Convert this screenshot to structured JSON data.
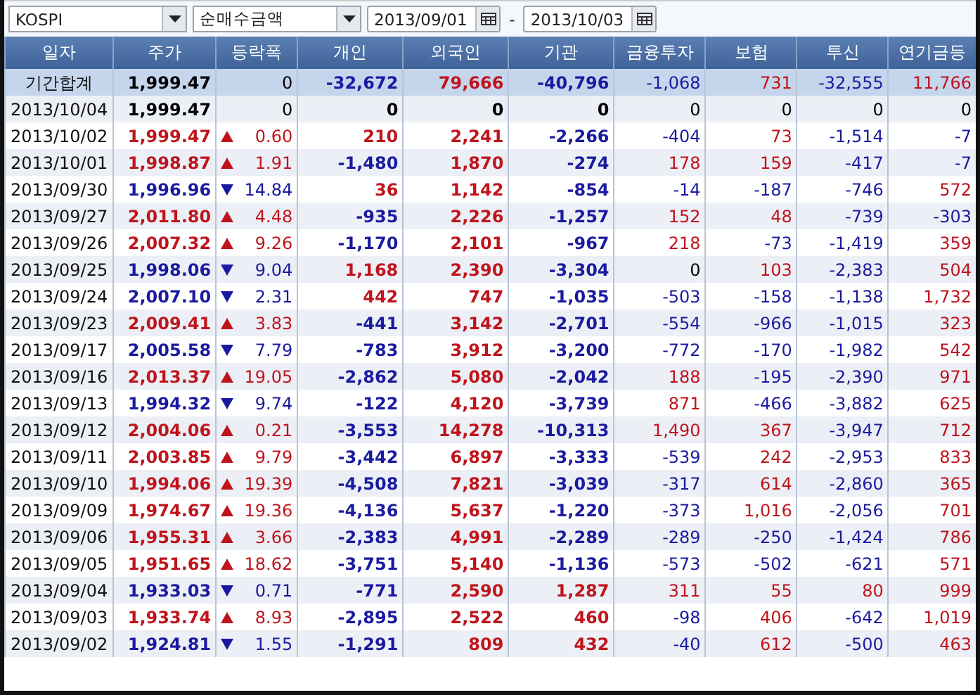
{
  "toolbar": {
    "market": {
      "value": "KOSPI"
    },
    "measure": {
      "value": "순매수금액"
    },
    "date_from": {
      "value": "2013/09/01"
    },
    "separator": "-",
    "date_to": {
      "value": "2013/10/03"
    }
  },
  "table": {
    "columns": [
      "일자",
      "주가",
      "등락폭",
      "개인",
      "외국인",
      "기관",
      "금융투자",
      "보험",
      "투신",
      "연기금등"
    ],
    "summary": {
      "cells": [
        {
          "text": "기간합계"
        },
        {
          "text": "1,999.47",
          "color": "#000000"
        },
        {
          "text": "0",
          "color": "#000000"
        },
        {
          "text": "-32,672",
          "color": "#1a1aa0"
        },
        {
          "text": "79,666",
          "color": "#c0141c"
        },
        {
          "text": "-40,796",
          "color": "#1a1aa0"
        },
        {
          "text": "-1,068",
          "color": "#1a1aa0"
        },
        {
          "text": "731",
          "color": "#c0141c"
        },
        {
          "text": "-32,555",
          "color": "#1a1aa0"
        },
        {
          "text": "11,766",
          "color": "#c0141c"
        }
      ]
    },
    "rows": [
      {
        "cells": [
          {
            "text": "2013/10/04"
          },
          {
            "text": "1,999.47",
            "color": "#000000"
          },
          {
            "text": "0",
            "color": "#000000"
          },
          {
            "text": "0",
            "color": "#000000"
          },
          {
            "text": "0",
            "color": "#000000"
          },
          {
            "text": "0",
            "color": "#000000"
          },
          {
            "text": "0",
            "color": "#000000"
          },
          {
            "text": "0",
            "color": "#000000"
          },
          {
            "text": "0",
            "color": "#000000"
          },
          {
            "text": "0",
            "color": "#000000"
          }
        ]
      },
      {
        "cells": [
          {
            "text": "2013/10/02"
          },
          {
            "text": "1,999.47",
            "color": "#c0141c"
          },
          {
            "text": "0.60",
            "color": "#c0141c",
            "rising": true
          },
          {
            "text": "210",
            "color": "#c0141c"
          },
          {
            "text": "2,241",
            "color": "#c0141c"
          },
          {
            "text": "-2,266",
            "color": "#1a1aa0"
          },
          {
            "text": "-404",
            "color": "#1a1aa0"
          },
          {
            "text": "73",
            "color": "#c0141c"
          },
          {
            "text": "-1,514",
            "color": "#1a1aa0"
          },
          {
            "text": "-7",
            "color": "#1a1aa0"
          }
        ]
      },
      {
        "cells": [
          {
            "text": "2013/10/01"
          },
          {
            "text": "1,998.87",
            "color": "#c0141c"
          },
          {
            "text": "1.91",
            "color": "#c0141c",
            "rising": true
          },
          {
            "text": "-1,480",
            "color": "#1a1aa0"
          },
          {
            "text": "1,870",
            "color": "#c0141c"
          },
          {
            "text": "-274",
            "color": "#1a1aa0"
          },
          {
            "text": "178",
            "color": "#c0141c"
          },
          {
            "text": "159",
            "color": "#c0141c"
          },
          {
            "text": "-417",
            "color": "#1a1aa0"
          },
          {
            "text": "-7",
            "color": "#1a1aa0"
          }
        ]
      },
      {
        "cells": [
          {
            "text": "2013/09/30"
          },
          {
            "text": "1,996.96",
            "color": "#1a1aa0"
          },
          {
            "text": "14.84",
            "color": "#1a1aa0",
            "falling": true
          },
          {
            "text": "36",
            "color": "#c0141c"
          },
          {
            "text": "1,142",
            "color": "#c0141c"
          },
          {
            "text": "-854",
            "color": "#1a1aa0"
          },
          {
            "text": "-14",
            "color": "#1a1aa0"
          },
          {
            "text": "-187",
            "color": "#1a1aa0"
          },
          {
            "text": "-746",
            "color": "#1a1aa0"
          },
          {
            "text": "572",
            "color": "#c0141c"
          }
        ]
      },
      {
        "cells": [
          {
            "text": "2013/09/27"
          },
          {
            "text": "2,011.80",
            "color": "#c0141c"
          },
          {
            "text": "4.48",
            "color": "#c0141c",
            "rising": true
          },
          {
            "text": "-935",
            "color": "#1a1aa0"
          },
          {
            "text": "2,226",
            "color": "#c0141c"
          },
          {
            "text": "-1,257",
            "color": "#1a1aa0"
          },
          {
            "text": "152",
            "color": "#c0141c"
          },
          {
            "text": "48",
            "color": "#c0141c"
          },
          {
            "text": "-739",
            "color": "#1a1aa0"
          },
          {
            "text": "-303",
            "color": "#1a1aa0"
          }
        ]
      },
      {
        "cells": [
          {
            "text": "2013/09/26"
          },
          {
            "text": "2,007.32",
            "color": "#c0141c"
          },
          {
            "text": "9.26",
            "color": "#c0141c",
            "rising": true
          },
          {
            "text": "-1,170",
            "color": "#1a1aa0"
          },
          {
            "text": "2,101",
            "color": "#c0141c"
          },
          {
            "text": "-967",
            "color": "#1a1aa0"
          },
          {
            "text": "218",
            "color": "#c0141c"
          },
          {
            "text": "-73",
            "color": "#1a1aa0"
          },
          {
            "text": "-1,419",
            "color": "#1a1aa0"
          },
          {
            "text": "359",
            "color": "#c0141c"
          }
        ]
      },
      {
        "cells": [
          {
            "text": "2013/09/25"
          },
          {
            "text": "1,998.06",
            "color": "#1a1aa0"
          },
          {
            "text": "9.04",
            "color": "#1a1aa0",
            "falling": true
          },
          {
            "text": "1,168",
            "color": "#c0141c"
          },
          {
            "text": "2,390",
            "color": "#c0141c"
          },
          {
            "text": "-3,304",
            "color": "#1a1aa0"
          },
          {
            "text": "0",
            "color": "#000000"
          },
          {
            "text": "103",
            "color": "#c0141c"
          },
          {
            "text": "-2,383",
            "color": "#1a1aa0"
          },
          {
            "text": "504",
            "color": "#c0141c"
          }
        ]
      },
      {
        "cells": [
          {
            "text": "2013/09/24"
          },
          {
            "text": "2,007.10",
            "color": "#1a1aa0"
          },
          {
            "text": "2.31",
            "color": "#1a1aa0",
            "falling": true
          },
          {
            "text": "442",
            "color": "#c0141c"
          },
          {
            "text": "747",
            "color": "#c0141c"
          },
          {
            "text": "-1,035",
            "color": "#1a1aa0"
          },
          {
            "text": "-503",
            "color": "#1a1aa0"
          },
          {
            "text": "-158",
            "color": "#1a1aa0"
          },
          {
            "text": "-1,138",
            "color": "#1a1aa0"
          },
          {
            "text": "1,732",
            "color": "#c0141c"
          }
        ]
      },
      {
        "cells": [
          {
            "text": "2013/09/23"
          },
          {
            "text": "2,009.41",
            "color": "#c0141c"
          },
          {
            "text": "3.83",
            "color": "#c0141c",
            "rising": true
          },
          {
            "text": "-441",
            "color": "#1a1aa0"
          },
          {
            "text": "3,142",
            "color": "#c0141c"
          },
          {
            "text": "-2,701",
            "color": "#1a1aa0"
          },
          {
            "text": "-554",
            "color": "#1a1aa0"
          },
          {
            "text": "-966",
            "color": "#1a1aa0"
          },
          {
            "text": "-1,015",
            "color": "#1a1aa0"
          },
          {
            "text": "323",
            "color": "#c0141c"
          }
        ]
      },
      {
        "cells": [
          {
            "text": "2013/09/17"
          },
          {
            "text": "2,005.58",
            "color": "#1a1aa0"
          },
          {
            "text": "7.79",
            "color": "#1a1aa0",
            "falling": true
          },
          {
            "text": "-783",
            "color": "#1a1aa0"
          },
          {
            "text": "3,912",
            "color": "#c0141c"
          },
          {
            "text": "-3,200",
            "color": "#1a1aa0"
          },
          {
            "text": "-772",
            "color": "#1a1aa0"
          },
          {
            "text": "-170",
            "color": "#1a1aa0"
          },
          {
            "text": "-1,982",
            "color": "#1a1aa0"
          },
          {
            "text": "542",
            "color": "#c0141c"
          }
        ]
      },
      {
        "cells": [
          {
            "text": "2013/09/16"
          },
          {
            "text": "2,013.37",
            "color": "#c0141c"
          },
          {
            "text": "19.05",
            "color": "#c0141c",
            "rising": true
          },
          {
            "text": "-2,862",
            "color": "#1a1aa0"
          },
          {
            "text": "5,080",
            "color": "#c0141c"
          },
          {
            "text": "-2,042",
            "color": "#1a1aa0"
          },
          {
            "text": "188",
            "color": "#c0141c"
          },
          {
            "text": "-195",
            "color": "#1a1aa0"
          },
          {
            "text": "-2,390",
            "color": "#1a1aa0"
          },
          {
            "text": "971",
            "color": "#c0141c"
          }
        ]
      },
      {
        "cells": [
          {
            "text": "2013/09/13"
          },
          {
            "text": "1,994.32",
            "color": "#1a1aa0"
          },
          {
            "text": "9.74",
            "color": "#1a1aa0",
            "falling": true
          },
          {
            "text": "-122",
            "color": "#1a1aa0"
          },
          {
            "text": "4,120",
            "color": "#c0141c"
          },
          {
            "text": "-3,739",
            "color": "#1a1aa0"
          },
          {
            "text": "871",
            "color": "#c0141c"
          },
          {
            "text": "-466",
            "color": "#1a1aa0"
          },
          {
            "text": "-3,882",
            "color": "#1a1aa0"
          },
          {
            "text": "625",
            "color": "#c0141c"
          }
        ]
      },
      {
        "cells": [
          {
            "text": "2013/09/12"
          },
          {
            "text": "2,004.06",
            "color": "#c0141c"
          },
          {
            "text": "0.21",
            "color": "#c0141c",
            "rising": true
          },
          {
            "text": "-3,553",
            "color": "#1a1aa0"
          },
          {
            "text": "14,278",
            "color": "#c0141c"
          },
          {
            "text": "-10,313",
            "color": "#1a1aa0"
          },
          {
            "text": "1,490",
            "color": "#c0141c"
          },
          {
            "text": "367",
            "color": "#c0141c"
          },
          {
            "text": "-3,947",
            "color": "#1a1aa0"
          },
          {
            "text": "712",
            "color": "#c0141c"
          }
        ]
      },
      {
        "cells": [
          {
            "text": "2013/09/11"
          },
          {
            "text": "2,003.85",
            "color": "#c0141c"
          },
          {
            "text": "9.79",
            "color": "#c0141c",
            "rising": true
          },
          {
            "text": "-3,442",
            "color": "#1a1aa0"
          },
          {
            "text": "6,897",
            "color": "#c0141c"
          },
          {
            "text": "-3,333",
            "color": "#1a1aa0"
          },
          {
            "text": "-539",
            "color": "#1a1aa0"
          },
          {
            "text": "242",
            "color": "#c0141c"
          },
          {
            "text": "-2,953",
            "color": "#1a1aa0"
          },
          {
            "text": "833",
            "color": "#c0141c"
          }
        ]
      },
      {
        "cells": [
          {
            "text": "2013/09/10"
          },
          {
            "text": "1,994.06",
            "color": "#c0141c"
          },
          {
            "text": "19.39",
            "color": "#c0141c",
            "rising": true
          },
          {
            "text": "-4,508",
            "color": "#1a1aa0"
          },
          {
            "text": "7,821",
            "color": "#c0141c"
          },
          {
            "text": "-3,039",
            "color": "#1a1aa0"
          },
          {
            "text": "-317",
            "color": "#1a1aa0"
          },
          {
            "text": "614",
            "color": "#c0141c"
          },
          {
            "text": "-2,860",
            "color": "#1a1aa0"
          },
          {
            "text": "365",
            "color": "#c0141c"
          }
        ]
      },
      {
        "cells": [
          {
            "text": "2013/09/09"
          },
          {
            "text": "1,974.67",
            "color": "#c0141c"
          },
          {
            "text": "19.36",
            "color": "#c0141c",
            "rising": true
          },
          {
            "text": "-4,136",
            "color": "#1a1aa0"
          },
          {
            "text": "5,637",
            "color": "#c0141c"
          },
          {
            "text": "-1,220",
            "color": "#1a1aa0"
          },
          {
            "text": "-373",
            "color": "#1a1aa0"
          },
          {
            "text": "1,016",
            "color": "#c0141c"
          },
          {
            "text": "-2,056",
            "color": "#1a1aa0"
          },
          {
            "text": "701",
            "color": "#c0141c"
          }
        ]
      },
      {
        "cells": [
          {
            "text": "2013/09/06"
          },
          {
            "text": "1,955.31",
            "color": "#c0141c"
          },
          {
            "text": "3.66",
            "color": "#c0141c",
            "rising": true
          },
          {
            "text": "-2,383",
            "color": "#1a1aa0"
          },
          {
            "text": "4,991",
            "color": "#c0141c"
          },
          {
            "text": "-2,289",
            "color": "#1a1aa0"
          },
          {
            "text": "-289",
            "color": "#1a1aa0"
          },
          {
            "text": "-250",
            "color": "#1a1aa0"
          },
          {
            "text": "-1,424",
            "color": "#1a1aa0"
          },
          {
            "text": "786",
            "color": "#c0141c"
          }
        ]
      },
      {
        "cells": [
          {
            "text": "2013/09/05"
          },
          {
            "text": "1,951.65",
            "color": "#c0141c"
          },
          {
            "text": "18.62",
            "color": "#c0141c",
            "rising": true
          },
          {
            "text": "-3,751",
            "color": "#1a1aa0"
          },
          {
            "text": "5,140",
            "color": "#c0141c"
          },
          {
            "text": "-1,136",
            "color": "#1a1aa0"
          },
          {
            "text": "-573",
            "color": "#1a1aa0"
          },
          {
            "text": "-502",
            "color": "#1a1aa0"
          },
          {
            "text": "-621",
            "color": "#1a1aa0"
          },
          {
            "text": "571",
            "color": "#c0141c"
          }
        ]
      },
      {
        "cells": [
          {
            "text": "2013/09/04"
          },
          {
            "text": "1,933.03",
            "color": "#1a1aa0"
          },
          {
            "text": "0.71",
            "color": "#1a1aa0",
            "falling": true
          },
          {
            "text": "-771",
            "color": "#1a1aa0"
          },
          {
            "text": "2,590",
            "color": "#c0141c"
          },
          {
            "text": "1,287",
            "color": "#c0141c"
          },
          {
            "text": "311",
            "color": "#c0141c"
          },
          {
            "text": "55",
            "color": "#c0141c"
          },
          {
            "text": "80",
            "color": "#c0141c"
          },
          {
            "text": "999",
            "color": "#c0141c"
          }
        ]
      },
      {
        "cells": [
          {
            "text": "2013/09/03"
          },
          {
            "text": "1,933.74",
            "color": "#c0141c"
          },
          {
            "text": "8.93",
            "color": "#c0141c",
            "rising": true
          },
          {
            "text": "-2,895",
            "color": "#1a1aa0"
          },
          {
            "text": "2,522",
            "color": "#c0141c"
          },
          {
            "text": "460",
            "color": "#c0141c"
          },
          {
            "text": "-98",
            "color": "#1a1aa0"
          },
          {
            "text": "406",
            "color": "#c0141c"
          },
          {
            "text": "-642",
            "color": "#1a1aa0"
          },
          {
            "text": "1,019",
            "color": "#c0141c"
          }
        ]
      },
      {
        "cells": [
          {
            "text": "2013/09/02"
          },
          {
            "text": "1,924.81",
            "color": "#1a1aa0"
          },
          {
            "text": "1.55",
            "color": "#1a1aa0",
            "falling": true
          },
          {
            "text": "-1,291",
            "color": "#1a1aa0"
          },
          {
            "text": "809",
            "color": "#c0141c"
          },
          {
            "text": "432",
            "color": "#c0141c"
          },
          {
            "text": "-40",
            "color": "#1a1aa0"
          },
          {
            "text": "612",
            "color": "#c0141c"
          },
          {
            "text": "-500",
            "color": "#1a1aa0"
          },
          {
            "text": "463",
            "color": "#c0141c"
          }
        ]
      }
    ]
  }
}
